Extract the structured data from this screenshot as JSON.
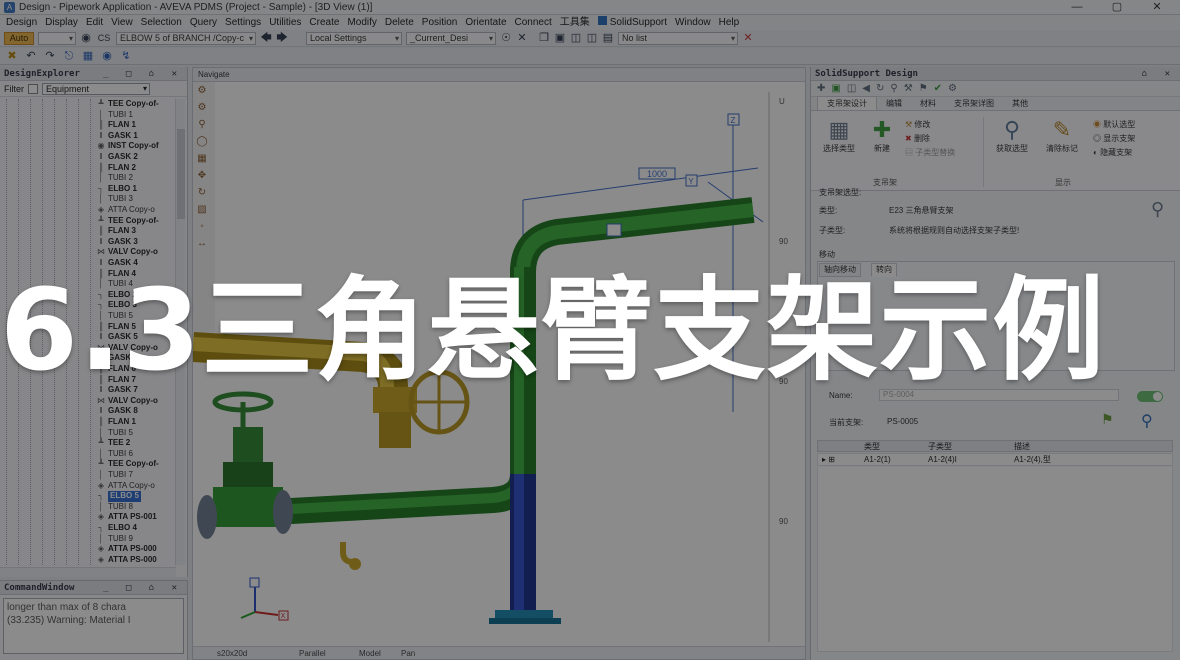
{
  "window": {
    "title": "Design - Pipework Application - AVEVA PDMS (Project - Sample) - [3D View (1)]",
    "controls": [
      "—",
      "▢",
      "✕"
    ]
  },
  "menu": [
    "Design",
    "Display",
    "Edit",
    "View",
    "Selection",
    "Query",
    "Settings",
    "Utilities",
    "Create",
    "Modify",
    "Delete",
    "Position",
    "Orientate",
    "Connect",
    "工具集",
    "SolidSupport",
    "Window",
    "Help"
  ],
  "toolbar": {
    "auto_label": "Auto",
    "cs_label": "CS",
    "element_combo": "ELBOW 5 of BRANCH /Copy-c",
    "settings_combo": "Local Settings",
    "current_combo": "_Current_Desi",
    "list_combo": "No list"
  },
  "explorer": {
    "title": "DesignExplorer",
    "filter_label": "Filter",
    "filter_value": "Equipment",
    "items": [
      {
        "label": "TEE Copy-of-",
        "icon": "tee-icon",
        "bold": true
      },
      {
        "label": "TUBI 1",
        "icon": "tube-icon",
        "bold": false
      },
      {
        "label": "FLAN 1",
        "icon": "flange-icon",
        "bold": true
      },
      {
        "label": "GASK 1",
        "icon": "gasket-icon",
        "bold": true
      },
      {
        "label": "INST Copy-of",
        "icon": "instrument-icon",
        "bold": true
      },
      {
        "label": "GASK 2",
        "icon": "gasket-icon",
        "bold": true
      },
      {
        "label": "FLAN 2",
        "icon": "flange-icon",
        "bold": true
      },
      {
        "label": "TUBI 2",
        "icon": "tube-icon",
        "bold": false
      },
      {
        "label": "ELBO 1",
        "icon": "elbow-icon",
        "bold": true
      },
      {
        "label": "TUBI 3",
        "icon": "tube-icon",
        "bold": false
      },
      {
        "label": "ATTA Copy-o",
        "icon": "attachment-icon",
        "bold": false
      },
      {
        "label": "TEE Copy-of-",
        "icon": "tee-icon",
        "bold": true
      },
      {
        "label": "FLAN 3",
        "icon": "flange-icon",
        "bold": true
      },
      {
        "label": "GASK 3",
        "icon": "gasket-icon",
        "bold": true
      },
      {
        "label": "VALV Copy-o",
        "icon": "valve-icon",
        "bold": true
      },
      {
        "label": "GASK 4",
        "icon": "gasket-icon",
        "bold": true
      },
      {
        "label": "FLAN 4",
        "icon": "flange-icon",
        "bold": true
      },
      {
        "label": "TUBI 4",
        "icon": "tube-icon",
        "bold": false
      },
      {
        "label": "ELBO 2",
        "icon": "elbow-icon",
        "bold": true
      },
      {
        "label": "ELBO 3",
        "icon": "elbow-icon",
        "bold": true
      },
      {
        "label": "TUBI 5",
        "icon": "tube-icon",
        "bold": false
      },
      {
        "label": "FLAN 5",
        "icon": "flange-icon",
        "bold": true
      },
      {
        "label": "GASK 5",
        "icon": "gasket-icon",
        "bold": true
      },
      {
        "label": "VALV Copy-o",
        "icon": "valve-icon",
        "bold": true
      },
      {
        "label": "GASK 6",
        "icon": "gasket-icon",
        "bold": true
      },
      {
        "label": "FLAN 6",
        "icon": "flange-icon",
        "bold": true
      },
      {
        "label": "FLAN 7",
        "icon": "flange-icon",
        "bold": true
      },
      {
        "label": "GASK 7",
        "icon": "gasket-icon",
        "bold": true
      },
      {
        "label": "VALV Copy-o",
        "icon": "valve-icon",
        "bold": true
      },
      {
        "label": "GASK 8",
        "icon": "gasket-icon",
        "bold": true
      },
      {
        "label": "FLAN 1",
        "icon": "flange-icon",
        "bold": true
      },
      {
        "label": "TUBI 5",
        "icon": "tube-icon",
        "bold": false
      },
      {
        "label": "TEE 2",
        "icon": "tee-icon",
        "bold": true
      },
      {
        "label": "TUBI 6",
        "icon": "tube-icon",
        "bold": false
      },
      {
        "label": "TEE Copy-of-",
        "icon": "tee-icon",
        "bold": true
      },
      {
        "label": "TUBI 7",
        "icon": "tube-icon",
        "bold": false
      },
      {
        "label": "ATTA Copy-o",
        "icon": "attachment-icon",
        "bold": false
      },
      {
        "label": "ELBO 5",
        "icon": "elbow-icon",
        "bold": true,
        "selected": true
      },
      {
        "label": "TUBI 8",
        "icon": "tube-icon",
        "bold": false
      },
      {
        "label": "ATTA PS-001",
        "icon": "attachment-icon",
        "bold": true
      },
      {
        "label": "ELBO 4",
        "icon": "elbow-icon",
        "bold": true
      },
      {
        "label": "TUBI 9",
        "icon": "tube-icon",
        "bold": false
      },
      {
        "label": "ATTA PS-000",
        "icon": "attachment-icon",
        "bold": true
      },
      {
        "label": "ATTA PS-000",
        "icon": "attachment-icon",
        "bold": true
      }
    ]
  },
  "command_window": {
    "title": "CommandWindow",
    "lines": [
      "longer than max of 8 chara",
      "(33.235) Warning: Material I"
    ]
  },
  "view": {
    "tab_label": "Navigate",
    "dimension_label": "1000",
    "axis_labels": [
      "Z",
      "Y",
      "X"
    ],
    "scale_labels": [
      "U",
      "90",
      "90",
      "90"
    ],
    "status": {
      "size": "s20x20d",
      "projection": "Parallel",
      "mode": "Model",
      "action": "Pan"
    },
    "colors": {
      "pipe_green": "#2e9a2e",
      "pipe_blue": "#1f3fb4",
      "valve_yellow": "#d8b72a",
      "dimension": "#3c6ac4"
    }
  },
  "solidsupport": {
    "title": "SolidSupport Design",
    "tabs": [
      "支吊架设计",
      "编辑",
      "材料",
      "支吊架详图",
      "其他"
    ],
    "buttons": {
      "select_type": "选择类型",
      "new": "新建",
      "modify": "修改",
      "delete": "删除",
      "subtype_replace": "子类型替换",
      "get_selection": "获取选型",
      "clear_marks": "清除标记",
      "default_selection": "默认选型",
      "show_support": "显示支架",
      "hide_support": "隐藏支架"
    },
    "groups": {
      "support": "支吊架",
      "display": "显示"
    },
    "selection_title": "支吊架选型:",
    "type_label": "类型:",
    "type_value": "E23   三角悬臂支架",
    "subtype_label": "子类型:",
    "subtype_value": "系统将根据规则自动选择支架子类型!",
    "move_title": "移动",
    "move_tabs": [
      "轴向移动",
      "转向"
    ],
    "name_label": "Name:",
    "name_value": "PS-0004",
    "current_support_label": "当前支架:",
    "current_support_value": "PS-0005",
    "grid_headers": [
      "类型",
      "子类型",
      "描述"
    ],
    "grid_row": [
      "A1-2(1)",
      "A1-2(4)I",
      "A1-2(4),型"
    ]
  },
  "overlay": {
    "title": "6.3三角悬臂支架示例"
  }
}
